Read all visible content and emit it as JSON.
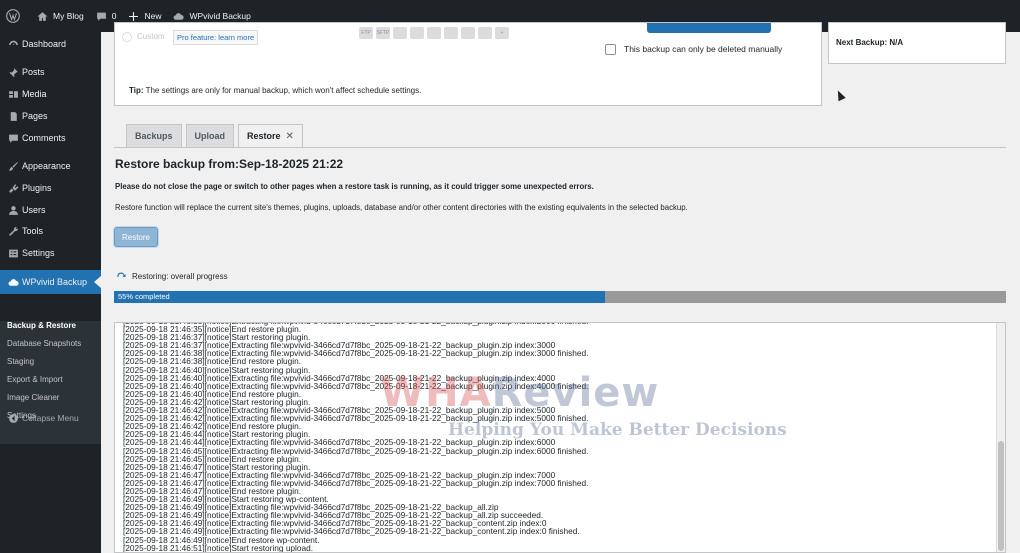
{
  "adminbar": {
    "site_name": "My Blog",
    "comments_count": "0",
    "new_label": "New",
    "plugin_label": "WPvivid Backup"
  },
  "sidebar": {
    "items": [
      {
        "label": "Dashboard",
        "icon": "dashboard-icon"
      },
      {
        "label": "Posts",
        "icon": "pin-icon"
      },
      {
        "label": "Media",
        "icon": "media-icon"
      },
      {
        "label": "Pages",
        "icon": "pages-icon"
      },
      {
        "label": "Comments",
        "icon": "comment-icon"
      },
      {
        "label": "Appearance",
        "icon": "brush-icon"
      },
      {
        "label": "Plugins",
        "icon": "plugin-icon"
      },
      {
        "label": "Users",
        "icon": "user-icon"
      },
      {
        "label": "Tools",
        "icon": "wrench-icon"
      },
      {
        "label": "Settings",
        "icon": "settings-icon"
      },
      {
        "label": "WPvivid Backup",
        "icon": "cloud-icon"
      }
    ],
    "submenu": [
      "Backup & Restore",
      "Database Snapshots",
      "Staging",
      "Export & Import",
      "Image Cleaner",
      "Settings"
    ],
    "collapse_label": "Collapse Menu"
  },
  "top_panel": {
    "custom_label": "Custom",
    "pro_link": "Pro feature: learn more",
    "storage_icons": [
      "FTP",
      "SFTP",
      "S3",
      "drive",
      "dropbox",
      "onedrive",
      "wasabi",
      "b2",
      "add"
    ],
    "manual_delete_label": "This backup can only be deleted manually",
    "tip_bold": "Tip:",
    "tip_text": " The settings are only for manual backup, which won't affect schedule settings.",
    "next_backup": "Next Backup: N/A"
  },
  "tabs": [
    {
      "label": "Backups"
    },
    {
      "label": "Upload"
    },
    {
      "label": "Restore"
    }
  ],
  "restore": {
    "title": "Restore backup from:Sep-18-2025 21:22",
    "warning": "Please do not close the page or switch to other pages when a restore task is running, as it could trigger some unexpected errors.",
    "info": "Restore function will replace the current site's themes, plugins, uploads, database and/or other content directories with the existing equivalents in the selected backup.",
    "button_label": "Restore",
    "progress_label": "Restoring: overall progress",
    "progress_text": "55% completed",
    "progress_value": 0.55
  },
  "log": [
    "[2025-09-18 21:46:35][notice]Extracting file:wpvivid-3466cd7d7f8bc_2025-09-18-21-22_backup_plugin.zip index:2000 finished.",
    "[2025-09-18 21:46:35][notice]End restore plugin.",
    "[2025-09-18 21:46:37][notice]Start restoring plugin.",
    "[2025-09-18 21:46:37][notice]Extracting file:wpvivid-3466cd7d7f8bc_2025-09-18-21-22_backup_plugin.zip index:3000",
    "[2025-09-18 21:46:38][notice]Extracting file:wpvivid-3466cd7d7f8bc_2025-09-18-21-22_backup_plugin.zip index:3000 finished.",
    "[2025-09-18 21:46:38][notice]End restore plugin.",
    "[2025-09-18 21:46:40][notice]Start restoring plugin.",
    "[2025-09-18 21:46:40][notice]Extracting file:wpvivid-3466cd7d7f8bc_2025-09-18-21-22_backup_plugin.zip index:4000",
    "[2025-09-18 21:46:40][notice]Extracting file:wpvivid-3466cd7d7f8bc_2025-09-18-21-22_backup_plugin.zip index:4000 finished.",
    "[2025-09-18 21:46:40][notice]End restore plugin.",
    "[2025-09-18 21:46:42][notice]Start restoring plugin.",
    "[2025-09-18 21:46:42][notice]Extracting file:wpvivid-3466cd7d7f8bc_2025-09-18-21-22_backup_plugin.zip index:5000",
    "[2025-09-18 21:46:42][notice]Extracting file:wpvivid-3466cd7d7f8bc_2025-09-18-21-22_backup_plugin.zip index:5000 finished.",
    "[2025-09-18 21:46:42][notice]End restore plugin.",
    "[2025-09-18 21:46:44][notice]Start restoring plugin.",
    "[2025-09-18 21:46:44][notice]Extracting file:wpvivid-3466cd7d7f8bc_2025-09-18-21-22_backup_plugin.zip index:6000",
    "[2025-09-18 21:46:45][notice]Extracting file:wpvivid-3466cd7d7f8bc_2025-09-18-21-22_backup_plugin.zip index:6000 finished.",
    "[2025-09-18 21:46:45][notice]End restore plugin.",
    "[2025-09-18 21:46:47][notice]Start restoring plugin.",
    "[2025-09-18 21:46:47][notice]Extracting file:wpvivid-3466cd7d7f8bc_2025-09-18-21-22_backup_plugin.zip index:7000",
    "[2025-09-18 21:46:47][notice]Extracting file:wpvivid-3466cd7d7f8bc_2025-09-18-21-22_backup_plugin.zip index:7000 finished.",
    "[2025-09-18 21:46:47][notice]End restore plugin.",
    "[2025-09-18 21:46:49][notice]Start restoring wp-content.",
    "[2025-09-18 21:46:49][notice]Extracting file:wpvivid-3466cd7d7f8bc_2025-09-18-21-22_backup_all.zip",
    "[2025-09-18 21:46:49][notice]Extracting file:wpvivid-3466cd7d7f8bc_2025-09-18-21-22_backup_all.zip succeeded.",
    "[2025-09-18 21:46:49][notice]Extracting file:wpvivid-3466cd7d7f8bc_2025-09-18-21-22_backup_content.zip index:0",
    "[2025-09-18 21:46:49][notice]Extracting file:wpvivid-3466cd7d7f8bc_2025-09-18-21-22_backup_content.zip index:0 finished.",
    "[2025-09-18 21:46:49][notice]End restore wp-content.",
    "[2025-09-18 21:46:51][notice]Start restoring upload."
  ],
  "watermark": {
    "brand_a": "WHA",
    "brand_b": "Review",
    "slogan": "Helping You Make Better Decisions"
  }
}
